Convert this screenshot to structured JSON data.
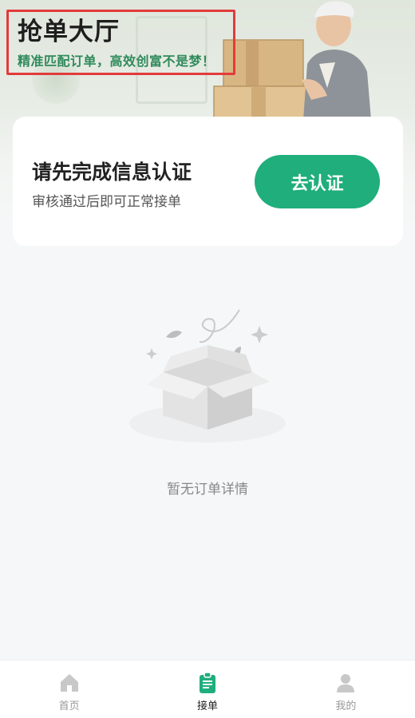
{
  "header": {
    "title": "抢单大厅",
    "slogan": "精准匹配订单，高效创富不是梦！"
  },
  "cert_card": {
    "title": "请先完成信息认证",
    "subtitle": "审核通过后即可正常接单",
    "button_label": "去认证"
  },
  "empty_state": {
    "text": "暂无订单详情"
  },
  "tabbar": {
    "items": [
      {
        "label": "首页",
        "icon": "home-icon",
        "active": false
      },
      {
        "label": "接单",
        "icon": "clipboard-icon",
        "active": true
      },
      {
        "label": "我的",
        "icon": "user-icon",
        "active": false
      }
    ]
  },
  "colors": {
    "accent": "#1fae7c",
    "slogan": "#2f8a5b",
    "highlight_border": "#e23b3b"
  }
}
